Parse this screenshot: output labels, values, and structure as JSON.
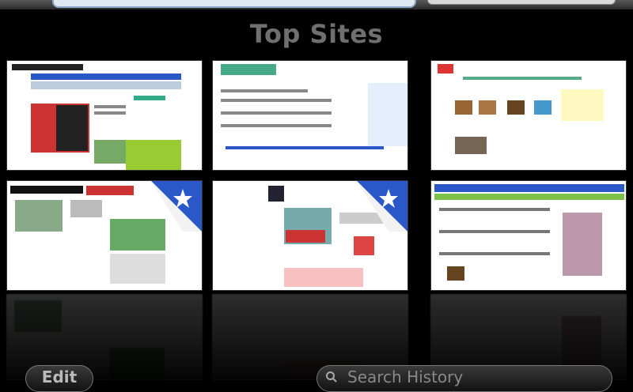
{
  "header": {
    "title": "Top Sites"
  },
  "toolbar": {
    "edit_label": "Edit",
    "search_label": "Search History"
  },
  "tiles": [
    {
      "name": "tile-news-1",
      "pinned": false
    },
    {
      "name": "tile-google",
      "pinned": false
    },
    {
      "name": "tile-portal",
      "pinned": false
    },
    {
      "name": "tile-news-2",
      "pinned": true
    },
    {
      "name": "tile-news-3",
      "pinned": true
    },
    {
      "name": "tile-portal-2",
      "pinned": false
    }
  ],
  "colors": {
    "accent": "#2a58c8",
    "star": "#ffffff"
  }
}
